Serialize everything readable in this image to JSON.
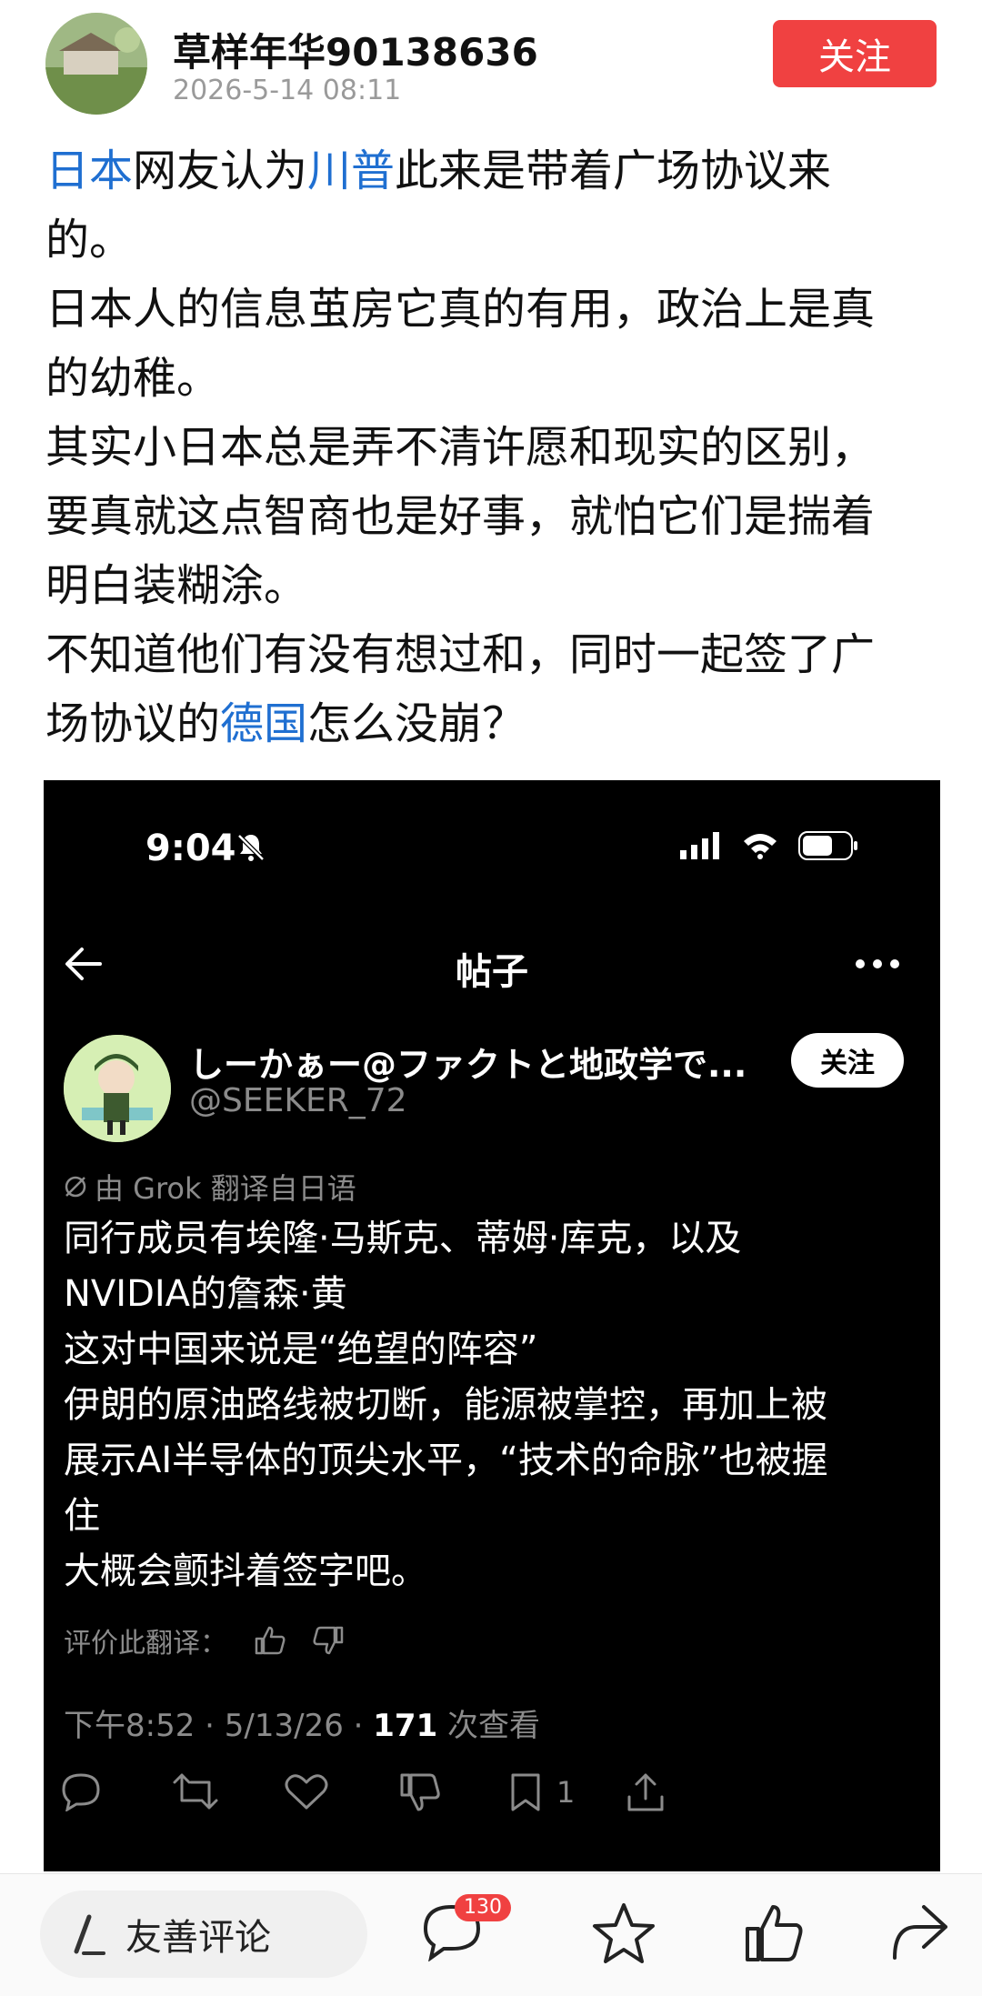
{
  "header": {
    "author": "草样年华90138636",
    "date": "2026-5-14 08:11",
    "follow_label": "关注"
  },
  "post": {
    "lines": [
      [
        {
          "text": "日本",
          "link": true
        },
        {
          "text": "网友认为"
        },
        {
          "text": "川普",
          "link": true
        },
        {
          "text": "此来是带着广场协议来"
        }
      ],
      [
        {
          "text": "的。"
        }
      ],
      [
        {
          "text": "日本人的信息茧房它真的有用，政治上是真"
        }
      ],
      [
        {
          "text": "的幼稚。"
        }
      ],
      [
        {
          "text": "其实小日本总是弄不清许愿和现实的区别，"
        }
      ],
      [
        {
          "text": "要真就这点智商也是好事，就怕它们是揣着"
        }
      ],
      [
        {
          "text": "明白装糊涂。"
        }
      ],
      [
        {
          "text": "不知道他们有没有想过和，同时一起签了广"
        }
      ],
      [
        {
          "text": "场协议的"
        },
        {
          "text": "德国",
          "link": true
        },
        {
          "text": "怎么没崩？"
        }
      ]
    ]
  },
  "shot": {
    "status_time": "9:04",
    "nav_title": "帖子",
    "user_name": "しーかぁー@ファクトと地政学で...",
    "user_handle": "@SEEKER_72",
    "follow_label": "关注",
    "grok_label": "由 Grok 翻译自日语",
    "tweet_lines": [
      "同行成员有埃隆·马斯克、蒂姆·库克，以及",
      "NVIDIA的詹森·黄",
      "这对中国来说是“绝望的阵容”",
      "伊朗的原油路线被切断，能源被掌控，再加上被",
      "展示AI半导体的顶尖水平，“技术的命脉”也被握",
      "住",
      "大概会颤抖着签字吧。"
    ],
    "rate_label": "评价此翻译：",
    "meta_time": "下午8:52 · 5/13/26 · ",
    "meta_views": "171",
    "meta_suffix": " 次查看",
    "bookmark_count": "1"
  },
  "bottom": {
    "comment_placeholder": "友善评论",
    "comment_count": "130"
  },
  "colors": {
    "accent": "#f04141",
    "link": "#1f6fd1"
  }
}
